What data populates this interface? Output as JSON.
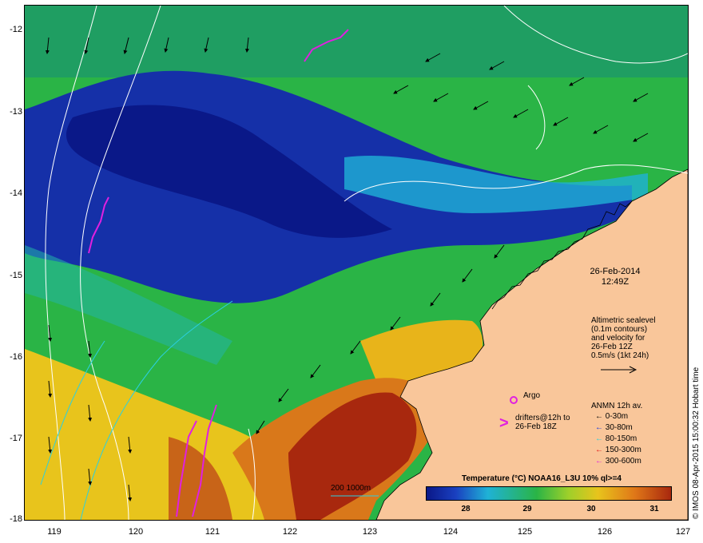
{
  "map": {
    "lat_ticks": [
      "-12",
      "-13",
      "-14",
      "-15",
      "-16",
      "-17",
      "-18"
    ],
    "lon_ticks": [
      "119",
      "120",
      "121",
      "122",
      "123",
      "124",
      "125",
      "126",
      "127"
    ],
    "colors": {
      "land": "#f9c69a",
      "cold": "#1a2a9a",
      "mid": "#27b548",
      "warm": "#e7c21a",
      "hot": "#a8280e",
      "contour": "#ffffff"
    }
  },
  "annotation": {
    "date": "26-Feb-2014",
    "time": "12:49Z",
    "sealevel_lines": [
      "Altimetric sealevel",
      "(0.1m contours)",
      "and velocity for",
      "26-Feb 12Z",
      "0.5m/s (1kt 24h)"
    ]
  },
  "legend": {
    "argo_label": "Argo",
    "drifter_lines": [
      "drifters@12h to",
      "26-Feb 18Z"
    ],
    "anmn_title": "ANMN 12h av.",
    "anmn_items": [
      {
        "label": "0-30m",
        "color": "#000000"
      },
      {
        "label": "30-80m",
        "color": "#1030e0"
      },
      {
        "label": "80-150m",
        "color": "#20d0e0"
      },
      {
        "label": "150-300m",
        "color": "#e01010"
      },
      {
        "label": "300-600m",
        "color": "#e020e0"
      }
    ],
    "bathy_label": "200 1000m"
  },
  "colorbar": {
    "title": "Temperature (°C) NOAA16_L3U 10% ql>=4",
    "ticks": [
      "28",
      "29",
      "30",
      "31"
    ]
  },
  "credit": "© IMOS 08-Apr-2015 15:00:32 Hobart time"
}
